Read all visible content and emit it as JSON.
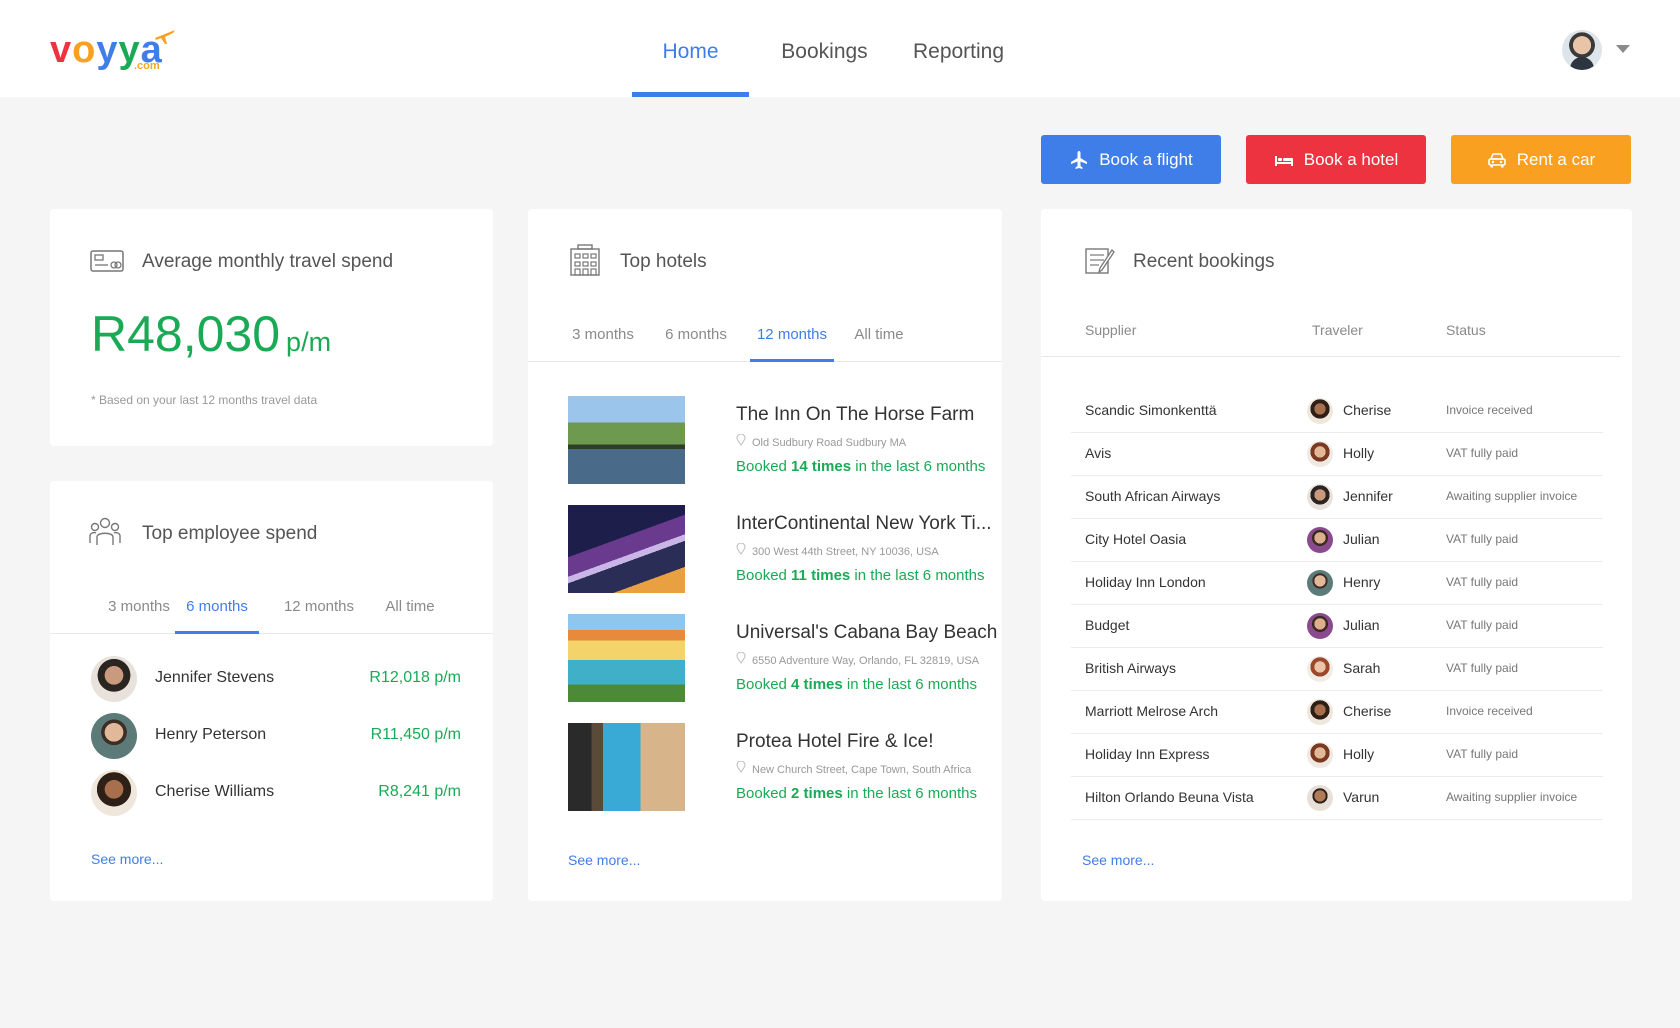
{
  "brand": {
    "letters": [
      "v",
      "o",
      "y",
      "y",
      "a"
    ],
    "letter_colors": [
      "#ee3340",
      "#f9a020",
      "#3f7ee8",
      "#1aaa55",
      "#3f7ee8"
    ],
    "suffix": ".com"
  },
  "nav": {
    "items": [
      {
        "label": "Home",
        "active": true
      },
      {
        "label": "Bookings",
        "active": false
      },
      {
        "label": "Reporting",
        "active": false
      }
    ]
  },
  "user": {
    "avatar": "user-avatar",
    "menu_icon": "chevron-down-icon"
  },
  "actions": {
    "book_flight": "Book a flight",
    "book_hotel": "Book a hotel",
    "rent_car": "Rent a car"
  },
  "spend": {
    "title": "Average monthly travel spend",
    "amount": "R48,030",
    "unit": "p/m",
    "note": "* Based on your last 12 months travel data"
  },
  "employees": {
    "title": "Top employee spend",
    "tabs": [
      {
        "label": "3 months",
        "active": false
      },
      {
        "label": "6 months",
        "active": true
      },
      {
        "label": "12 months",
        "active": false
      },
      {
        "label": "All time",
        "active": false
      }
    ],
    "rows": [
      {
        "name": "Jennifer Stevens",
        "amount": "R12,018 p/m"
      },
      {
        "name": "Henry Peterson",
        "amount": "R11,450 p/m"
      },
      {
        "name": "Cherise Williams",
        "amount": "R8,241 p/m"
      }
    ],
    "see_more": "See more..."
  },
  "hotels": {
    "title": "Top hotels",
    "tabs": [
      {
        "label": "3 months",
        "active": false
      },
      {
        "label": "6 months",
        "active": false
      },
      {
        "label": "12 months",
        "active": true
      },
      {
        "label": "All time",
        "active": false
      }
    ],
    "items": [
      {
        "name": "The Inn On The Horse Farm",
        "address": "Old Sudbury Road Sudbury MA",
        "pre": "Booked ",
        "count": "14 times",
        "post": " in the last 6 months"
      },
      {
        "name": "InterContinental New York Ti...",
        "address": "300 West 44th Street, NY 10036, USA",
        "pre": "Booked ",
        "count": "11 times",
        "post": " in the last 6 months"
      },
      {
        "name": "Universal's Cabana Bay Beach",
        "address": "6550 Adventure Way, Orlando, FL 32819, USA",
        "pre": "Booked ",
        "count": "4 times",
        "post": " in the last 6 months"
      },
      {
        "name": "Protea Hotel Fire & Ice!",
        "address": "New Church Street, Cape Town, South Africa",
        "pre": "Booked ",
        "count": "2 times",
        "post": " in the last 6 months"
      }
    ],
    "see_more": "See more..."
  },
  "bookings": {
    "title": "Recent bookings",
    "columns": {
      "supplier": "Supplier",
      "traveler": "Traveler",
      "status": "Status"
    },
    "rows": [
      {
        "supplier": "Scandic Simonkenttä",
        "traveler": "Cherise",
        "status": "Invoice received"
      },
      {
        "supplier": "Avis",
        "traveler": "Holly",
        "status": "VAT fully paid"
      },
      {
        "supplier": "South African Airways",
        "traveler": "Jennifer",
        "status": "Awaiting supplier invoice"
      },
      {
        "supplier": "City Hotel Oasia",
        "traveler": "Julian",
        "status": "VAT fully paid"
      },
      {
        "supplier": "Holiday Inn London",
        "traveler": "Henry",
        "status": "VAT fully paid"
      },
      {
        "supplier": "Budget",
        "traveler": "Julian",
        "status": "VAT fully paid"
      },
      {
        "supplier": "British Airways",
        "traveler": "Sarah",
        "status": "VAT fully paid"
      },
      {
        "supplier": "Marriott Melrose Arch",
        "traveler": "Cherise",
        "status": "Invoice received"
      },
      {
        "supplier": "Holiday Inn Express",
        "traveler": "Holly",
        "status": "VAT fully paid"
      },
      {
        "supplier": "Hilton Orlando Beuna Vista",
        "traveler": "Varun",
        "status": "Awaiting supplier invoice"
      }
    ],
    "see_more": "See more..."
  },
  "colors": {
    "accent": "#3f7ee8",
    "money": "#1aaa55",
    "hotel_button": "#ee3340",
    "car_button": "#f9a020"
  }
}
